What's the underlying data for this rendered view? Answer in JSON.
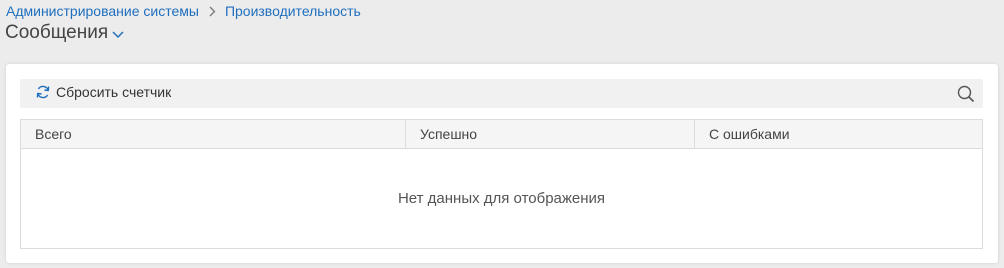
{
  "breadcrumb": {
    "items": [
      {
        "label": "Администрирование системы"
      },
      {
        "label": "Производительность"
      }
    ],
    "separator": "›"
  },
  "page": {
    "title": "Сообщения",
    "title_icon": "chevron-down-icon"
  },
  "toolbar": {
    "reset_label": "Сбросить счетчик",
    "reset_icon": "refresh-icon",
    "search_icon": "search-icon"
  },
  "grid": {
    "columns": [
      "Всего",
      "Успешно",
      "С ошибками"
    ],
    "empty_text": "Нет данных для отображения",
    "rows": []
  },
  "colors": {
    "link": "#1f6fbf",
    "background": "#ececec",
    "panel": "#ffffff",
    "toolbar": "#f1f1f1"
  }
}
